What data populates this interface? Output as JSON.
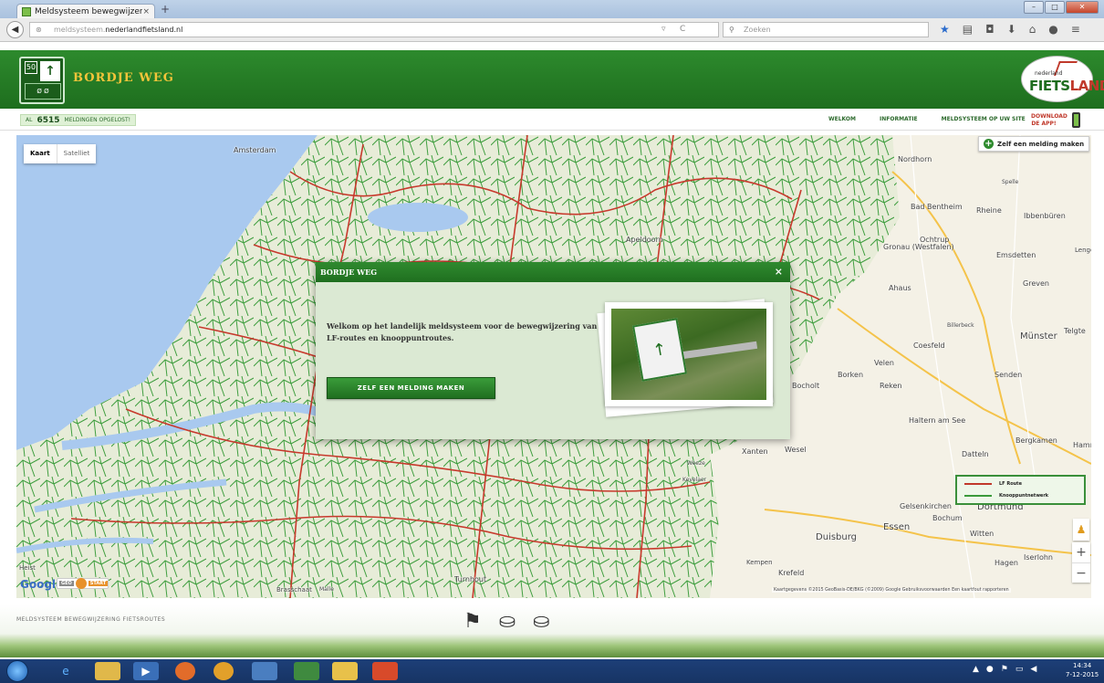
{
  "browser": {
    "tab_title": "Meldsysteem bewegwijzeri...",
    "tab_close": "×",
    "new_tab": "+",
    "url_prefix": "meldsysteem.",
    "url_domain": "nederlandfietsland.nl",
    "search_placeholder": "Zoeken",
    "icons": [
      "back-arrow-icon",
      "reload-icon",
      "bookmark-star-icon",
      "reading-list-icon",
      "pocket-icon",
      "download-icon",
      "home-icon",
      "chat-icon",
      "menu-icon"
    ]
  },
  "site": {
    "title": "BORDJE WEG",
    "logo_small": "nederland",
    "logo_big_1": "FIETS",
    "logo_big_2": "LAND",
    "counter_prefix": "AL",
    "counter_value": "6515",
    "counter_suffix": "MELDINGEN OPGELOST!",
    "nav": [
      "WELKOM",
      "INFORMATIE",
      "MELDSYSTEEM OP UW SITE"
    ],
    "download_line1": "DOWNLOAD",
    "download_line2": "DE APP!"
  },
  "map": {
    "type_map": "Kaart",
    "type_satellite": "Satelliet",
    "new_report": "Zelf een melding maken",
    "legend": {
      "lf": "LF Route",
      "knoop": "Knooppuntnetwerk"
    },
    "attribution": "Kaartgegevens ©2015 GeoBasis-DE/BKG (©2009) Google   Gebruiksvoorwaarden   Een kaartfout rapporteren",
    "google": "Google",
    "geo": "GEO",
    "start": "START",
    "labels": [
      "Amsterdam",
      "Nordhorn",
      "Bad Bentheim",
      "Rheine",
      "Ibbenbüren",
      "Gronau (Westfalen)",
      "Ochtrup",
      "Emsdetten",
      "Greven",
      "Ahaus",
      "Münster",
      "Telgte",
      "Coesfeld",
      "Billerbeck",
      "Velen",
      "Borken",
      "Reken",
      "Senden",
      "Haltern am See",
      "Wesel",
      "Xanten",
      "Datteln",
      "Bergkamen",
      "Hamm",
      "Kevelaer",
      "Weeze",
      "Gelsenkirchen",
      "Dortmund",
      "Bochum",
      "Essen",
      "Witten",
      "Duisburg",
      "Hagen",
      "Iserlohn",
      "Krefeld",
      "Kempen",
      "Turnhout",
      "Brasschaat",
      "Malle",
      "Heist",
      "Apeldoorn",
      "Bocholt",
      "Spelle",
      "Lengerich"
    ]
  },
  "modal": {
    "title": "BORDJE WEG",
    "close": "×",
    "body": "Welkom op het landelijk meldsysteem voor de bewegwijzering van LF-routes en knooppuntroutes.",
    "button": "ZELF EEN MELDING MAKEN"
  },
  "footer": {
    "text": "MELDSYSTEEM BEWEGWIJZERING FIETSROUTES"
  },
  "taskbar": {
    "time": "14:34",
    "date": "7-12-2015"
  },
  "colors": {
    "brand_green": "#2d8a2d",
    "lf_route": "#c0392b",
    "knooppunt": "#3a9a3a",
    "title_yellow": "#f3c43a"
  }
}
